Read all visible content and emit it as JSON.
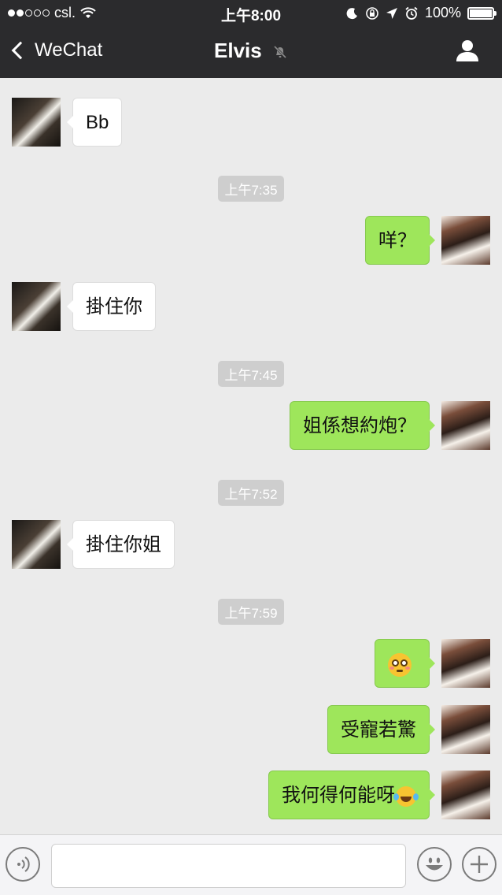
{
  "status_bar": {
    "carrier": "csl.",
    "time": "上午8:00",
    "battery": "100%",
    "battery_level": 1.0,
    "signal_bars_filled": 2,
    "signal_bars_total": 5
  },
  "nav": {
    "back_label": "WeChat",
    "title": "Elvis"
  },
  "messages": [
    {
      "side": "in",
      "text": "Bb"
    },
    {
      "type": "time",
      "text": "上午7:35"
    },
    {
      "side": "out",
      "text": "咩？"
    },
    {
      "side": "in",
      "text": "掛住你"
    },
    {
      "type": "time",
      "text": "上午7:45"
    },
    {
      "side": "out",
      "text": "姐係想約炮？"
    },
    {
      "type": "time",
      "text": "上午7:52"
    },
    {
      "side": "in",
      "text": "掛住你姐"
    },
    {
      "type": "time",
      "text": "上午7:59"
    },
    {
      "side": "out",
      "emoji": "flushed-face"
    },
    {
      "side": "out",
      "text": "受寵若驚"
    },
    {
      "side": "out",
      "text": "我何得何能呀",
      "emoji": "face-with-tears-of-joy"
    }
  ],
  "icons": {
    "back": "chevron-left-icon",
    "mute": "bell-slash-icon",
    "contact": "person-icon",
    "voice": "voice-icon",
    "sticker": "smile-icon",
    "more": "plus-icon"
  },
  "colors": {
    "nav_bg": "#2b2b2d",
    "chat_bg": "#ebebeb",
    "outgoing_bubble": "#9ee65b",
    "incoming_bubble": "#ffffff",
    "timestamp_bg": "#cecece"
  }
}
